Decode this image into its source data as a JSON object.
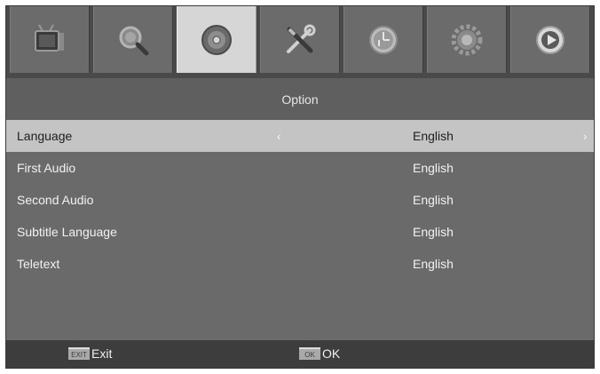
{
  "tabs": [
    {
      "icon": "tv-icon",
      "active": false
    },
    {
      "icon": "search-icon",
      "active": false
    },
    {
      "icon": "disc-icon",
      "active": true
    },
    {
      "icon": "tools-icon",
      "active": false
    },
    {
      "icon": "clock-icon",
      "active": false
    },
    {
      "icon": "gear-icon",
      "active": false
    },
    {
      "icon": "play-icon",
      "active": false
    }
  ],
  "title": "Option",
  "rows": [
    {
      "label": "Language",
      "value": "English",
      "selected": true
    },
    {
      "label": "First Audio",
      "value": "English",
      "selected": false
    },
    {
      "label": "Second Audio",
      "value": "English",
      "selected": false
    },
    {
      "label": "Subtitle Language",
      "value": "English",
      "selected": false
    },
    {
      "label": "Teletext",
      "value": "English",
      "selected": false
    }
  ],
  "arrows": {
    "left": "‹",
    "right": "›"
  },
  "footer": {
    "exit_key": "EXIT",
    "exit_label": "Exit",
    "ok_key": "OK",
    "ok_label": "OK"
  },
  "colors": {
    "background": "#6a6a6a",
    "selected_row": "#c4c4c4",
    "active_tab": "#d6d6d6",
    "bar": "#3d3d3d"
  }
}
